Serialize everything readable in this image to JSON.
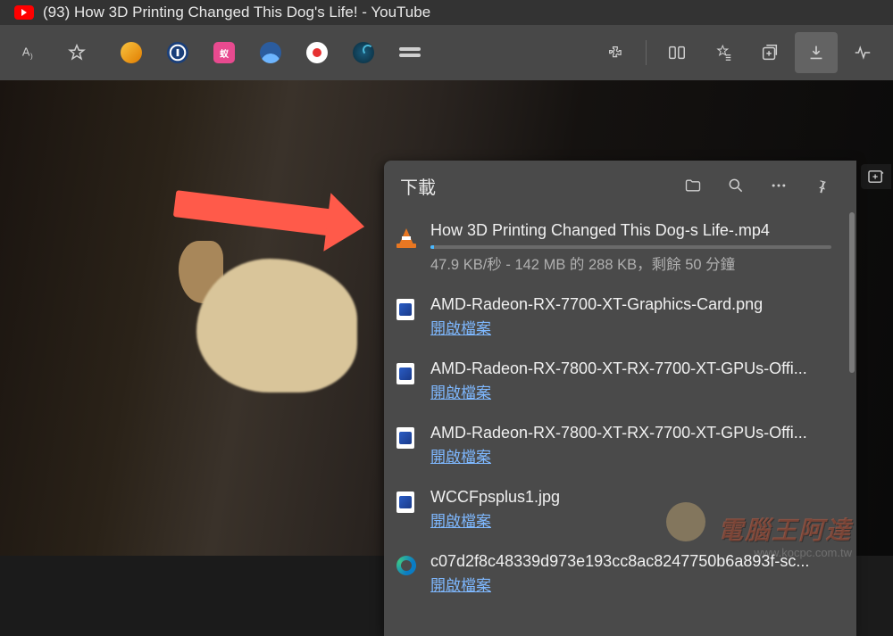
{
  "tab": {
    "title": "(93) How 3D Printing Changed This Dog's Life! - YouTube"
  },
  "downloads": {
    "title": "下載",
    "open_file_label": "開啟檔案",
    "items": [
      {
        "name": "How 3D Printing Changed This Dog-s Life-.mp4",
        "status": "47.9 KB/秒 - 142 MB 的 288 KB，剩餘 50 分鐘",
        "type": "video",
        "downloading": true
      },
      {
        "name": "AMD-Radeon-RX-7700-XT-Graphics-Card.png",
        "type": "image",
        "downloading": false
      },
      {
        "name": "AMD-Radeon-RX-7800-XT-RX-7700-XT-GPUs-Offi...",
        "type": "image",
        "downloading": false
      },
      {
        "name": "AMD-Radeon-RX-7800-XT-RX-7700-XT-GPUs-Offi...",
        "type": "image",
        "downloading": false
      },
      {
        "name": "WCCFpsplus1.jpg",
        "type": "image",
        "downloading": false
      },
      {
        "name": "c07d2f8c48339d973e193cc8ac8247750b6a893f-sc...",
        "type": "html",
        "downloading": false
      }
    ]
  },
  "watermark": {
    "text": "電腦王阿達",
    "url": "www.kocpc.com.tw"
  }
}
